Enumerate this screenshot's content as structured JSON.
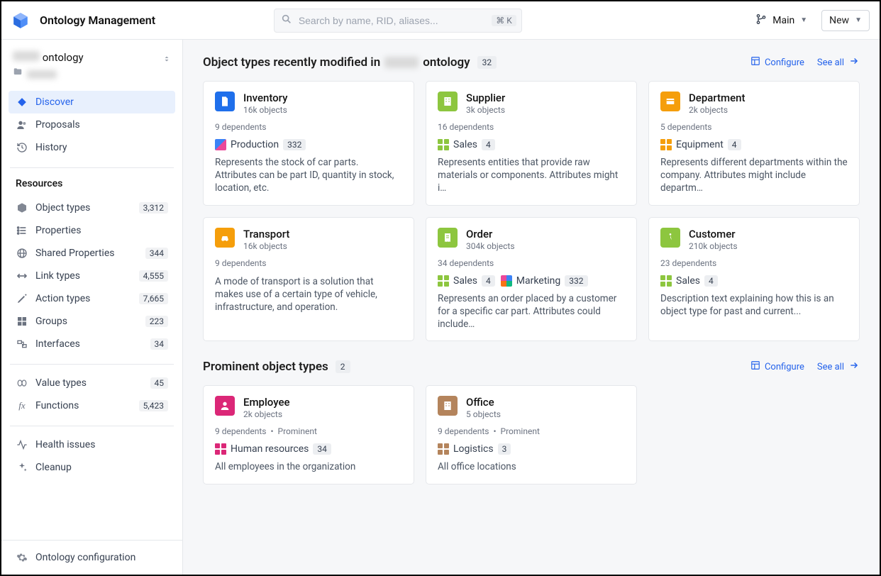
{
  "header": {
    "app_title": "Ontology Management",
    "search_placeholder": "Search by name, RID, aliases...",
    "kbd_hint": "⌘ K",
    "branch_label": "Main",
    "new_label": "New"
  },
  "sidebar": {
    "ontology_name_suffix": "ontology",
    "nav": [
      {
        "label": "Discover",
        "icon": "diamond-icon",
        "active": true
      },
      {
        "label": "Proposals",
        "icon": "users-icon",
        "active": false
      },
      {
        "label": "History",
        "icon": "history-icon",
        "active": false
      }
    ],
    "resources_title": "Resources",
    "resources": [
      {
        "label": "Object types",
        "icon": "cube-icon",
        "count": "3,312"
      },
      {
        "label": "Properties",
        "icon": "list-icon",
        "count": null
      },
      {
        "label": "Shared Properties",
        "icon": "globe-icon",
        "count": "344"
      },
      {
        "label": "Link types",
        "icon": "arrows-icon",
        "count": "4,555"
      },
      {
        "label": "Action types",
        "icon": "pencil-icon",
        "count": "7,665"
      },
      {
        "label": "Groups",
        "icon": "grid-icon",
        "count": "223"
      },
      {
        "label": "Interfaces",
        "icon": "interface-icon",
        "count": "34"
      }
    ],
    "resources2": [
      {
        "label": "Value types",
        "icon": "value-icon",
        "count": "45"
      },
      {
        "label": "Functions",
        "icon": "function-icon",
        "count": "5,423"
      }
    ],
    "resources3": [
      {
        "label": "Health issues",
        "icon": "pulse-icon",
        "count": null
      },
      {
        "label": "Cleanup",
        "icon": "sparkle-icon",
        "count": null
      }
    ],
    "bottom": {
      "label": "Ontology configuration",
      "icon": "gear-icon"
    }
  },
  "sections": {
    "recent": {
      "title_prefix": "Object types recently modified in",
      "title_suffix": "ontology",
      "count": "32",
      "configure_label": "Configure",
      "see_all_label": "See all",
      "cards": [
        {
          "icon_color": "blue",
          "icon_name": "document-icon",
          "title": "Inventory",
          "sub": "16k objects",
          "meta": "9 dependents",
          "tags": [
            {
              "style": "multi",
              "label": "Production",
              "count": "332"
            }
          ],
          "desc": "Represents the stock of car parts. Attributes can be part ID, quantity in stock, location, etc."
        },
        {
          "icon_color": "green",
          "icon_name": "building-icon",
          "title": "Supplier",
          "sub": "3k objects",
          "meta": "16 dependents",
          "tags": [
            {
              "style": "grid-green",
              "label": "Sales",
              "count": "4"
            }
          ],
          "desc": "Represents entities that provide raw materials or components. Attributes might i…"
        },
        {
          "icon_color": "orange",
          "icon_name": "card-icon",
          "title": "Department",
          "sub": "2k objects",
          "meta": "5 dependents",
          "tags": [
            {
              "style": "grid-orange",
              "label": "Equipment",
              "count": "4"
            }
          ],
          "desc": "Represents different departments within the company. Attributes might include departm…"
        },
        {
          "icon_color": "orange",
          "icon_name": "car-icon",
          "title": "Transport",
          "sub": "16k objects",
          "meta": "9 dependents",
          "tags": [],
          "desc": "A mode of transport is a solution that makes use of a certain type of vehicle, infrastructure, and operation."
        },
        {
          "icon_color": "green",
          "icon_name": "receipt-icon",
          "title": "Order",
          "sub": "304k objects",
          "meta": "34 dependents",
          "tags": [
            {
              "style": "grid-green",
              "label": "Sales",
              "count": "4"
            },
            {
              "style": "multi2",
              "label": "Marketing",
              "count": "332"
            }
          ],
          "desc": "Represents an order placed by a customer for a specific car part. Attributes could include…"
        },
        {
          "icon_color": "green",
          "icon_name": "walk-icon",
          "title": "Customer",
          "sub": "210k objects",
          "meta": "23 dependents",
          "tags": [
            {
              "style": "grid-green",
              "label": "Sales",
              "count": "4"
            }
          ],
          "desc": "Description text explaining how this is an object type for past and current..."
        }
      ]
    },
    "prominent": {
      "title": "Prominent object types",
      "count": "2",
      "configure_label": "Configure",
      "see_all_label": "See all",
      "cards": [
        {
          "icon_color": "pink",
          "icon_name": "person-icon",
          "title": "Employee",
          "sub": "2k objects",
          "meta": "9 dependents",
          "badge": "Prominent",
          "tags": [
            {
              "style": "grid-pink",
              "label": "Human resources",
              "count": "34"
            }
          ],
          "desc": "All employees in the organization"
        },
        {
          "icon_color": "brown",
          "icon_name": "office-icon",
          "title": "Office",
          "sub": "5 objects",
          "meta": "9 dependents",
          "badge": "Prominent",
          "tags": [
            {
              "style": "grid-brown",
              "label": "Logistics",
              "count": "3"
            }
          ],
          "desc": "All office locations"
        }
      ]
    }
  }
}
